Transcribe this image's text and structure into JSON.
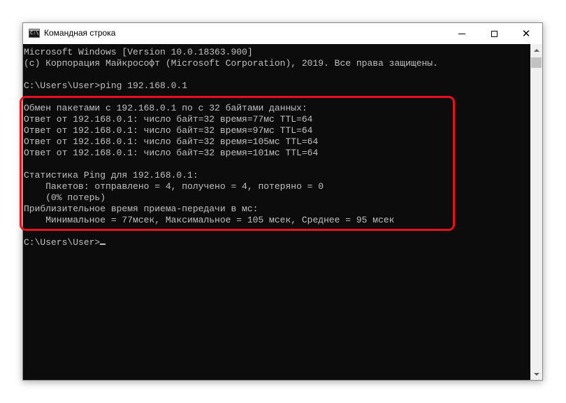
{
  "window": {
    "title": "Командная строка",
    "icon": "cmd-icon",
    "icon_text": "C:\\",
    "controls": {
      "minimize": "minimize-icon",
      "maximize": "maximize-icon",
      "close": "close-icon"
    }
  },
  "console": {
    "lines": [
      "Microsoft Windows [Version 10.0.18363.900]",
      "(c) Корпорация Майкрософт (Microsoft Corporation), 2019. Все права защищены.",
      "",
      "C:\\Users\\User>ping 192.168.0.1",
      "",
      "Обмен пакетами с 192.168.0.1 по с 32 байтами данных:",
      "Ответ от 192.168.0.1: число байт=32 время=77мс TTL=64",
      "Ответ от 192.168.0.1: число байт=32 время=97мс TTL=64",
      "Ответ от 192.168.0.1: число байт=32 время=105мс TTL=64",
      "Ответ от 192.168.0.1: число байт=32 время=101мс TTL=64",
      "",
      "Статистика Ping для 192.168.0.1:",
      "    Пакетов: отправлено = 4, получено = 4, потеряно = 0",
      "    (0% потерь)",
      "Приблизительное время приема-передачи в мс:",
      "    Минимальное = 77мсек, Максимальное = 105 мсек, Среднее = 95 мсек",
      ""
    ],
    "prompt": "C:\\Users\\User>"
  },
  "colors": {
    "console_bg": "#0c0c0c",
    "console_text": "#c0c0c0",
    "highlight": "#e8101e"
  }
}
